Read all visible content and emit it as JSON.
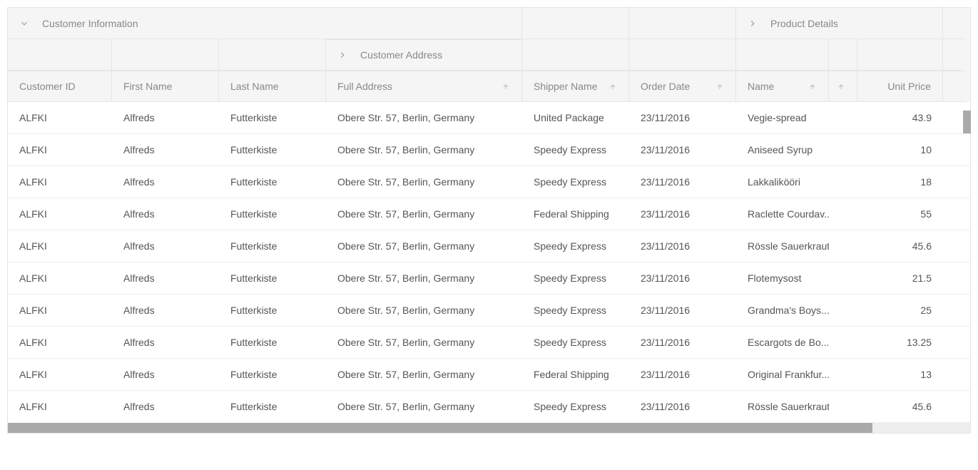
{
  "groups": {
    "customer_info": "Customer Information",
    "customer_address": "Customer Address",
    "product_details": "Product Details"
  },
  "columns": {
    "customer_id": "Customer ID",
    "first_name": "First Name",
    "last_name": "Last Name",
    "full_address": "Full Address",
    "shipper_name": "Shipper Name",
    "order_date": "Order Date",
    "name": "Name",
    "unit_price": "Unit Price"
  },
  "rows": [
    {
      "customer_id": "ALFKI",
      "first_name": "Alfreds",
      "last_name": "Futterkiste",
      "full_address": "Obere Str. 57, Berlin, Germany",
      "shipper_name": "United Package",
      "order_date": "23/11/2016",
      "name": "Vegie-spread",
      "unit_price": "43.9"
    },
    {
      "customer_id": "ALFKI",
      "first_name": "Alfreds",
      "last_name": "Futterkiste",
      "full_address": "Obere Str. 57, Berlin, Germany",
      "shipper_name": "Speedy Express",
      "order_date": "23/11/2016",
      "name": "Aniseed Syrup",
      "unit_price": "10"
    },
    {
      "customer_id": "ALFKI",
      "first_name": "Alfreds",
      "last_name": "Futterkiste",
      "full_address": "Obere Str. 57, Berlin, Germany",
      "shipper_name": "Speedy Express",
      "order_date": "23/11/2016",
      "name": "Lakkalikööri",
      "unit_price": "18"
    },
    {
      "customer_id": "ALFKI",
      "first_name": "Alfreds",
      "last_name": "Futterkiste",
      "full_address": "Obere Str. 57, Berlin, Germany",
      "shipper_name": "Federal Shipping",
      "order_date": "23/11/2016",
      "name": "Raclette Courdav...",
      "unit_price": "55"
    },
    {
      "customer_id": "ALFKI",
      "first_name": "Alfreds",
      "last_name": "Futterkiste",
      "full_address": "Obere Str. 57, Berlin, Germany",
      "shipper_name": "Speedy Express",
      "order_date": "23/11/2016",
      "name": "Rössle Sauerkraut",
      "unit_price": "45.6"
    },
    {
      "customer_id": "ALFKI",
      "first_name": "Alfreds",
      "last_name": "Futterkiste",
      "full_address": "Obere Str. 57, Berlin, Germany",
      "shipper_name": "Speedy Express",
      "order_date": "23/11/2016",
      "name": "Flotemysost",
      "unit_price": "21.5"
    },
    {
      "customer_id": "ALFKI",
      "first_name": "Alfreds",
      "last_name": "Futterkiste",
      "full_address": "Obere Str. 57, Berlin, Germany",
      "shipper_name": "Speedy Express",
      "order_date": "23/11/2016",
      "name": "Grandma's Boys...",
      "unit_price": "25"
    },
    {
      "customer_id": "ALFKI",
      "first_name": "Alfreds",
      "last_name": "Futterkiste",
      "full_address": "Obere Str. 57, Berlin, Germany",
      "shipper_name": "Speedy Express",
      "order_date": "23/11/2016",
      "name": "Escargots de Bo...",
      "unit_price": "13.25"
    },
    {
      "customer_id": "ALFKI",
      "first_name": "Alfreds",
      "last_name": "Futterkiste",
      "full_address": "Obere Str. 57, Berlin, Germany",
      "shipper_name": "Federal Shipping",
      "order_date": "23/11/2016",
      "name": "Original Frankfur...",
      "unit_price": "13"
    },
    {
      "customer_id": "ALFKI",
      "first_name": "Alfreds",
      "last_name": "Futterkiste",
      "full_address": "Obere Str. 57, Berlin, Germany",
      "shipper_name": "Speedy Express",
      "order_date": "23/11/2016",
      "name": "Rössle Sauerkraut",
      "unit_price": "45.6"
    }
  ]
}
